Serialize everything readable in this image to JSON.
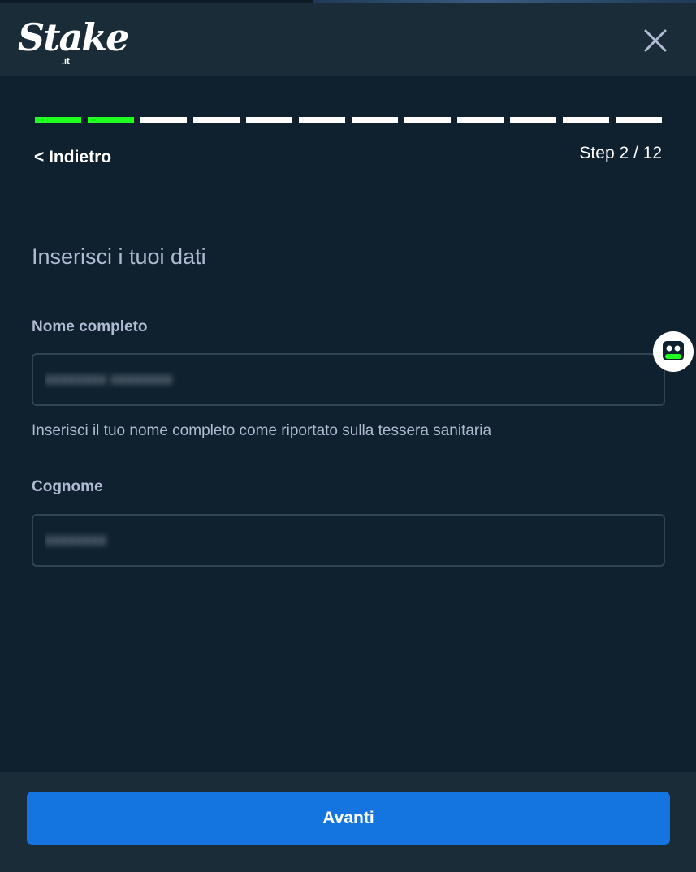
{
  "brand": {
    "logo_text": "Stake",
    "logo_tld": ".it"
  },
  "progress": {
    "current_step": 2,
    "total_steps": 12,
    "completed_color": "#1fff20"
  },
  "nav": {
    "back_label": "< Indietro",
    "step_label": "Step 2 / 12"
  },
  "form": {
    "title": "Inserisci i tuoi dati",
    "full_name": {
      "label": "Nome completo",
      "helper": "Inserisci il tuo nome completo come riportato sulla tessera sanitaria"
    },
    "surname": {
      "label": "Cognome"
    }
  },
  "footer": {
    "primary_label": "Avanti"
  },
  "colors": {
    "background": "#0f212e",
    "header": "#1a2c38",
    "muted_text": "#b1bad3",
    "input_border": "#2f4553",
    "primary_button": "#1475e1"
  },
  "icons": {
    "close": "close-icon",
    "assistant": "robot-icon"
  }
}
